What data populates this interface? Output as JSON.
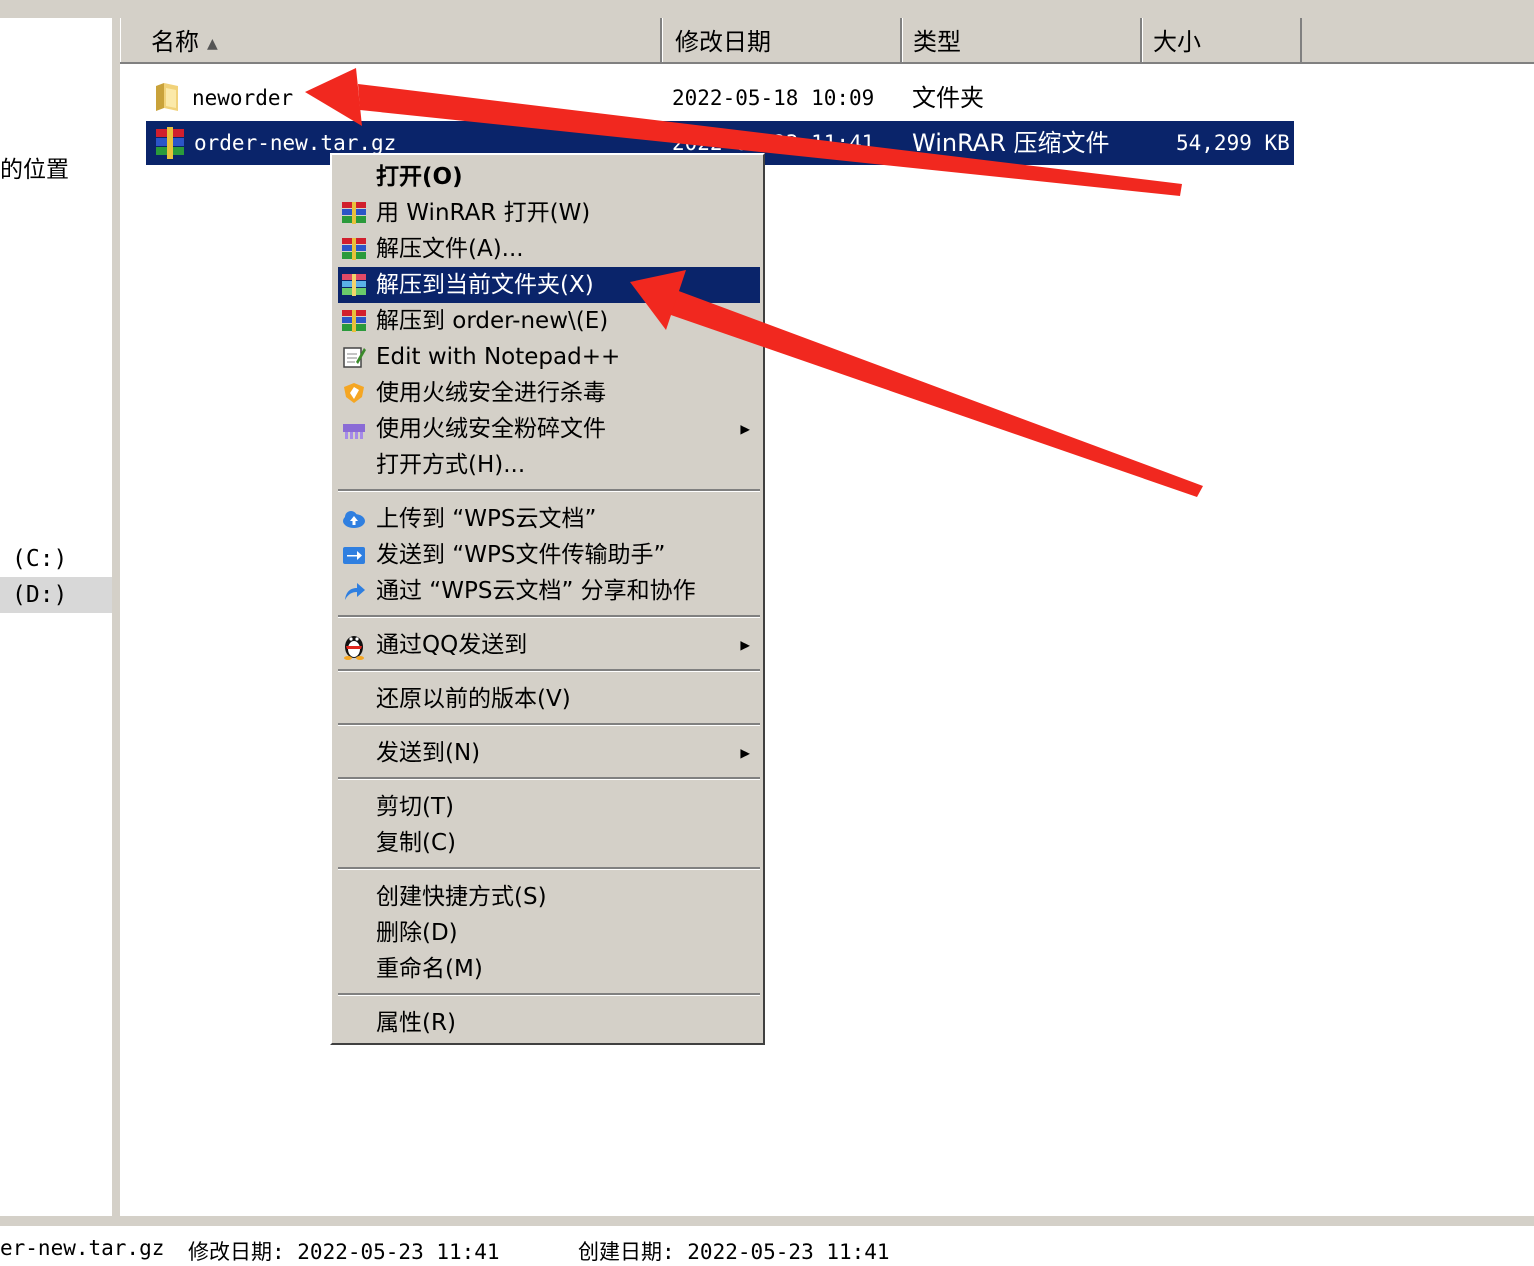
{
  "nav": {
    "partial_label": "的位置",
    "drive_c": "(C:)",
    "drive_d": "(D:)"
  },
  "columns": [
    {
      "label": "名称",
      "sorted": "ascending"
    },
    {
      "label": "修改日期"
    },
    {
      "label": "类型"
    },
    {
      "label": "大小"
    }
  ],
  "files": [
    {
      "name": "neworder",
      "modified": "2022-05-18 10:09",
      "type": "文件夹",
      "size": "",
      "icon": "folder-icon",
      "selected": false
    },
    {
      "name": "order-new.tar.gz",
      "modified": "2022-05-23 11:41",
      "type": "WinRAR 压缩文件",
      "size": "54,299 KB",
      "icon": "winrar-icon",
      "selected": true
    }
  ],
  "context_menu": {
    "items": [
      {
        "label": "打开(O)",
        "bold": true
      },
      {
        "label": "用 WinRAR 打开(W)",
        "icon": "winrar-icon"
      },
      {
        "label": "解压文件(A)...",
        "icon": "winrar-icon"
      },
      {
        "label": "解压到当前文件夹(X)",
        "icon": "winrar-icon",
        "highlighted": true
      },
      {
        "label": "解压到 order-new\\(E)",
        "icon": "winrar-icon"
      },
      {
        "label": "Edit with Notepad++",
        "icon": "notepad-icon"
      },
      {
        "label": "使用火绒安全进行杀毒",
        "icon": "huorong-shield-icon"
      },
      {
        "label": "使用火绒安全粉碎文件",
        "icon": "shredder-icon",
        "submenu": true
      },
      {
        "label": "打开方式(H)..."
      },
      {
        "label": "上传到 “WPS云文档”",
        "icon": "cloud-upload-icon"
      },
      {
        "label": "发送到 “WPS文件传输助手”",
        "icon": "send-arrow-icon"
      },
      {
        "label": "通过 “WPS云文档” 分享和协作",
        "icon": "share-icon"
      },
      {
        "label": "通过QQ发送到",
        "icon": "qq-penguin-icon",
        "submenu": true
      },
      {
        "label": "还原以前的版本(V)"
      },
      {
        "label": "发送到(N)",
        "submenu": true
      },
      {
        "label": "剪切(T)"
      },
      {
        "label": "复制(C)"
      },
      {
        "label": "创建快捷方式(S)"
      },
      {
        "label": "删除(D)"
      },
      {
        "label": "重命名(M)"
      },
      {
        "label": "属性(R)"
      }
    ]
  },
  "status": {
    "filename": "er-new.tar.gz",
    "modified": "修改日期: 2022-05-23 11:41",
    "created": "创建日期: 2022-05-23 11:41"
  },
  "colors": {
    "selection": "#0a246a",
    "chrome": "#d4d0c8",
    "annotation_arrow": "#f1281f"
  }
}
